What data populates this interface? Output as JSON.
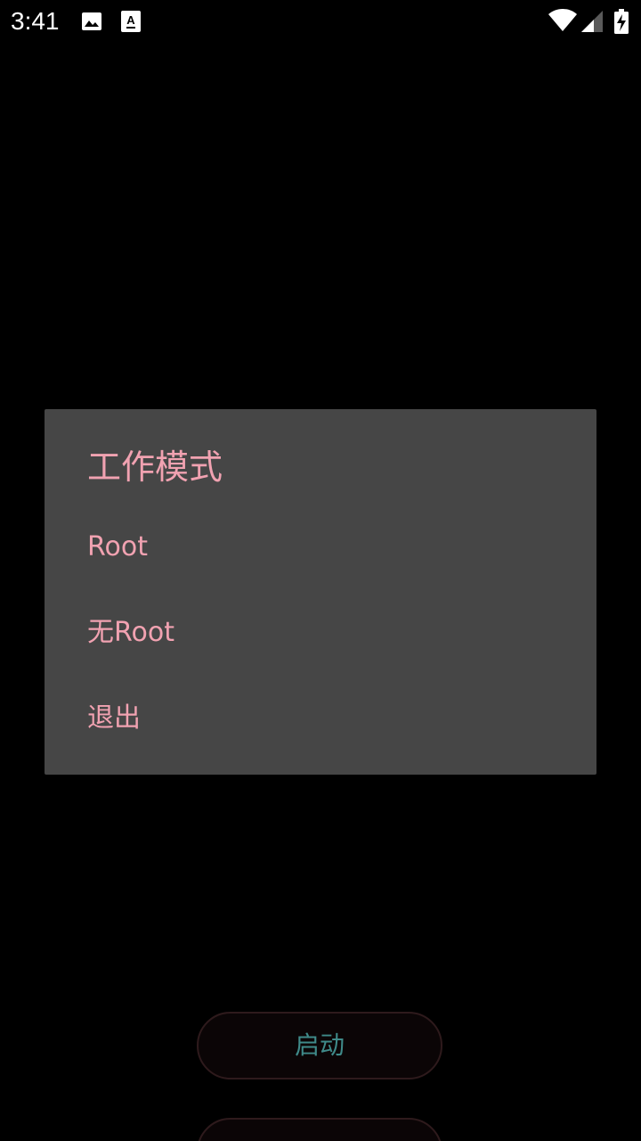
{
  "status_bar": {
    "time": "3:41",
    "left_icons": [
      "image-icon",
      "a-badge-icon"
    ],
    "right_icons": [
      "wifi-icon",
      "cell-signal-icon",
      "battery-charging-icon"
    ]
  },
  "dialog": {
    "title": "工作模式",
    "items": [
      {
        "label": "Root"
      },
      {
        "label": "无Root"
      },
      {
        "label": "退出"
      }
    ]
  },
  "background": {
    "start_button_label": "启动"
  },
  "colors": {
    "dialog_bg": "#464646",
    "dialog_text": "#f1a2b1",
    "button_text": "#3f8a89",
    "screen_bg": "#000000"
  }
}
